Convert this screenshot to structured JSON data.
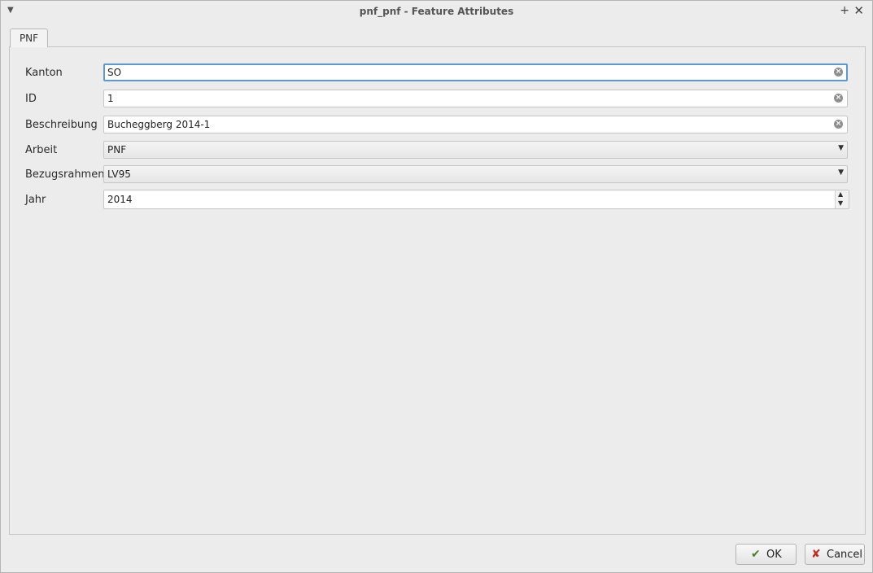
{
  "window": {
    "title": "pnf_pnf - Feature Attributes",
    "menu_icon": "chevron-down-icon",
    "pin_icon": "pin-plus-icon",
    "close_icon": "close-icon"
  },
  "tabs": [
    {
      "label": "PNF",
      "active": true
    }
  ],
  "form": {
    "kanton": {
      "label": "Kanton",
      "value": "SO"
    },
    "id": {
      "label": "ID",
      "value": "1"
    },
    "beschreibung": {
      "label": "Beschreibung",
      "value": "Bucheggberg 2014-1"
    },
    "arbeit": {
      "label": "Arbeit",
      "value": "PNF"
    },
    "bezugsrahmen": {
      "label": "Bezugsrahmen",
      "value": "LV95"
    },
    "jahr": {
      "label": "Jahr",
      "value": "2014"
    }
  },
  "buttons": {
    "ok": "OK",
    "cancel": "Cancel"
  },
  "colors": {
    "focus_border": "#5b9ad0",
    "ok_icon": "#4a7d2c",
    "cancel_icon": "#c42b1c"
  }
}
